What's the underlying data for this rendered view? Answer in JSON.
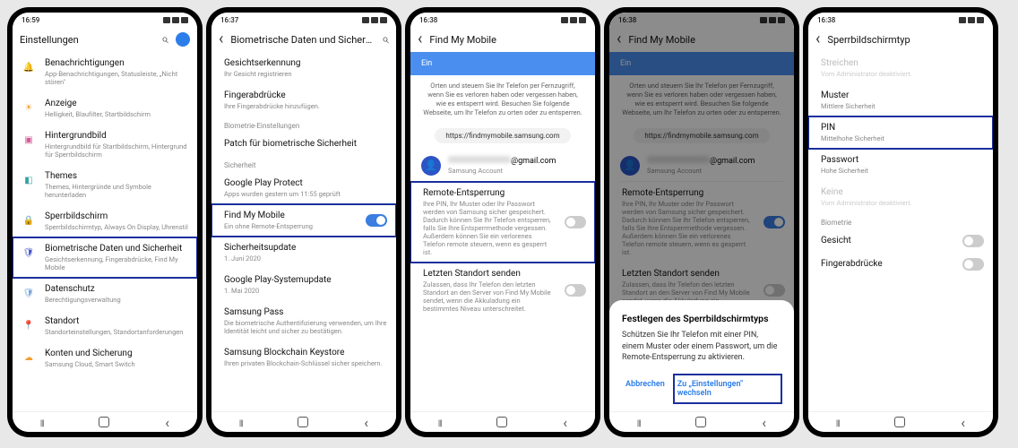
{
  "screens": [
    {
      "time": "16:59",
      "title": "Einstellungen",
      "back": false,
      "search": true,
      "avatar": true,
      "items": [
        {
          "icon": "🔔",
          "iconColor": "#e05858",
          "title": "Benachrichtigungen",
          "sub": "App-Benachrichtigungen, Statusleiste, „Nicht stören\""
        },
        {
          "icon": "☀",
          "iconColor": "#f0a030",
          "title": "Anzeige",
          "sub": "Helligkeit, Blaufilter, Startbildschirm"
        },
        {
          "icon": "▣",
          "iconColor": "#d65a9a",
          "title": "Hintergrundbild",
          "sub": "Hintergrundbild für Startbildschirm, Hintergrund für Sperrbildschirm"
        },
        {
          "icon": "◧",
          "iconColor": "#3aa3a3",
          "title": "Themes",
          "sub": "Themes, Hintergründe und Symbole herunterladen"
        },
        {
          "icon": "🔒",
          "iconColor": "#3a7fc4",
          "title": "Sperrbildschirm",
          "sub": "Sperrbildschirmtyp, Always On Display, Uhrenstil"
        },
        {
          "icon": "🛡",
          "iconColor": "#3a4fc4",
          "title": "Biometrische Daten und Sicherheit",
          "sub": "Gesichtserkennung, Fingerabdrücke, Find My Mobile",
          "hl": true
        },
        {
          "icon": "🛡",
          "iconColor": "#6fa0d8",
          "title": "Datenschutz",
          "sub": "Berechtigungsverwaltung"
        },
        {
          "icon": "📍",
          "iconColor": "#3aa85a",
          "title": "Standort",
          "sub": "Standorteinstellungen, Standortanforderungen"
        },
        {
          "icon": "☁",
          "iconColor": "#f0a030",
          "title": "Konten und Sicherung",
          "sub": "Samsung Cloud, Smart Switch"
        }
      ]
    },
    {
      "time": "16:37",
      "title": "Biometrische Daten und Sicherh...",
      "back": true,
      "search": true,
      "groups": [
        {
          "items": [
            {
              "title": "Gesichtserkennung",
              "sub": "Ihr Gesicht registrieren"
            },
            {
              "title": "Fingerabdrücke",
              "sub": "Ihre Fingerabdrücke hinzufügen."
            }
          ]
        },
        {
          "section": "Biometrie-Einstellungen",
          "items": [
            {
              "title": "Patch für biometrische Sicherheit"
            }
          ]
        },
        {
          "section": "Sicherheit",
          "items": [
            {
              "title": "Google Play Protect",
              "sub": "Apps wurden gestern um 11:55 geprüft"
            },
            {
              "title": "Find My Mobile",
              "sub": "Ein ohne Remote-Entsperrung",
              "toggle": "on",
              "hl": true
            },
            {
              "title": "Sicherheitsupdate",
              "sub": "1. Juni 2020"
            },
            {
              "title": "Google Play-Systemupdate",
              "sub": "1. Mai 2020"
            },
            {
              "title": "Samsung Pass",
              "sub": "Die biometrische Authentifizierung verwenden, um Ihre Identität leicht und sicher zu bestätigen."
            },
            {
              "title": "Samsung Blockchain Keystore",
              "sub": "Ihren privaten Blockchain-Schlüssel sicher speichern."
            }
          ]
        }
      ]
    },
    {
      "time": "16:38",
      "title": "Find My Mobile",
      "back": true,
      "banner": {
        "label": "Ein",
        "toggle": "on"
      },
      "desc": "Orten und steuern Sie Ihr Telefon per Fernzugriff, wenn Sie es verloren haben oder vergessen haben, wie es entsperrt wird. Besuchen Sie folgende Webseite, um Ihr Telefon zu orten oder zu entsperren.",
      "url": "https://findmymobile.samsung.com",
      "account_email": "@gmail.com",
      "account_sub": "Samsung Account",
      "items": [
        {
          "title": "Remote-Entsperrung",
          "sub": "Ihre PIN, Ihr Muster oder Ihr Passwort werden von Samsung sicher gespeichert. Dadurch können Sie Ihr Telefon entsperren, falls Sie Ihre Entsperrmethode vergessen. Außerdem können Sie ein verlorenes Telefon remote steuern, wenn es gesperrt ist.",
          "toggle": "off",
          "hl": true
        },
        {
          "title": "Letzten Standort senden",
          "sub": "Zulassen, dass Ihr Telefon den letzten Standort an den Server von Find My Mobile sendet, wenn die Akkuladung ein bestimmtes Niveau unterschreitet.",
          "toggle": "off"
        }
      ]
    },
    {
      "time": "16:38",
      "title": "Find My Mobile",
      "back": true,
      "dimmed": true,
      "banner": {
        "label": "Ein",
        "toggle": "on"
      },
      "desc": "Orten und steuern Sie Ihr Telefon per Fernzugriff, wenn Sie es verloren haben oder vergessen haben, wie es entsperrt wird. Besuchen Sie folgende Webseite, um Ihr Telefon zu orten oder zu entsperren.",
      "url": "https://findmymobile.samsung.com",
      "account_email": "@gmail.com",
      "account_sub": "Samsung Account",
      "items": [
        {
          "title": "Remote-Entsperrung",
          "sub": "Ihre PIN, Ihr Muster oder Ihr Passwort werden von Samsung sicher gespeichert. Dadurch können Sie Ihr Telefon entsperren, falls Sie Ihre Entsperrmethode vergessen. Außerdem können Sie ein verlorenes Telefon remote steuern, wenn es gesperrt ist.",
          "toggle": "on"
        },
        {
          "title": "Letzten Standort senden",
          "sub": "Zulassen, dass Ihr Telefon den letzten Standort an den Server von Find My Mobile sendet, wenn die Akkuladung ein bestimmtes Niveau unterschreitet.",
          "toggle": "off"
        }
      ],
      "dialog": {
        "title": "Festlegen des Sperrbildschirmtyps",
        "text": "Schützen Sie Ihr Telefon mit einer PIN, einem Muster oder einem Passwort, um die Remote-Entsperrung zu aktivieren.",
        "cancel": "Abbrechen",
        "ok": "Zu „Einstellungen\" wechseln"
      }
    },
    {
      "time": "16:38",
      "title": "Sperrbildschirmtyp",
      "back": true,
      "items": [
        {
          "title": "Streichen",
          "sub": "Vom Administrator deaktiviert.",
          "disabled": true
        },
        {
          "title": "Muster",
          "sub": "Mittlere Sicherheit"
        },
        {
          "title": "PIN",
          "sub": "Mittelhohe Sicherheit",
          "hl": true
        },
        {
          "title": "Passwort",
          "sub": "Hohe Sicherheit"
        },
        {
          "title": "Keine",
          "sub": "Vom Administrator deaktiviert.",
          "disabled": true
        }
      ],
      "section": "Biometrie",
      "bio": [
        {
          "title": "Gesicht",
          "toggle": "off"
        },
        {
          "title": "Fingerabdrücke",
          "toggle": "off"
        }
      ]
    }
  ]
}
